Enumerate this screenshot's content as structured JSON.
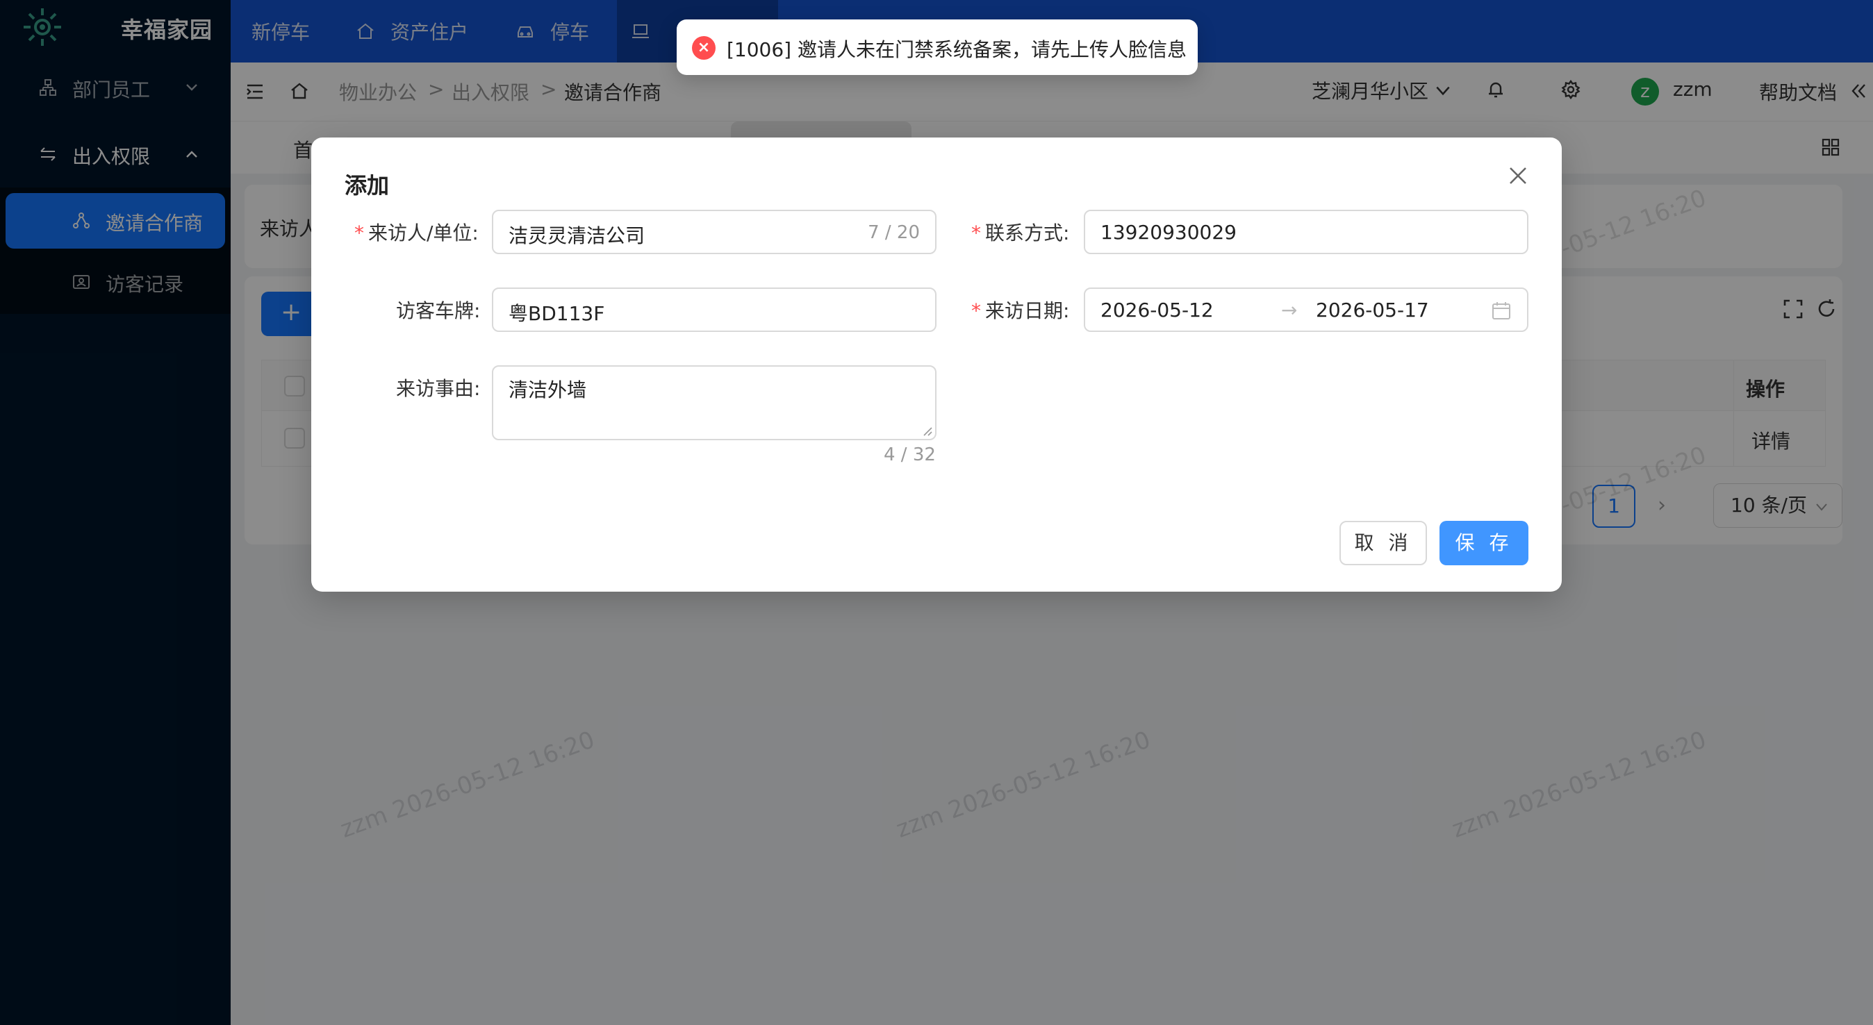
{
  "app": {
    "name": "幸福家园"
  },
  "sidebar": {
    "groups": [
      {
        "label": "部门员工",
        "icon": "org-chart-icon",
        "expanded": false
      },
      {
        "label": "出入权限",
        "icon": "swap-icon",
        "expanded": true
      }
    ],
    "items": [
      {
        "label": "邀请合作商",
        "icon": "share-nodes-icon",
        "active": true
      },
      {
        "label": "访客记录",
        "icon": "id-card-icon",
        "active": false
      }
    ]
  },
  "topnav": {
    "tabs": [
      {
        "label": "新停车",
        "icon": ""
      },
      {
        "label": "资产住户",
        "icon": "home-icon"
      },
      {
        "label": "停车",
        "icon": "car-icon"
      },
      {
        "label": "",
        "icon": "laptop-icon"
      }
    ]
  },
  "header": {
    "breadcrumb": [
      "物业办公",
      "出入权限",
      "邀请合作商"
    ],
    "community": "芝澜月华小区",
    "user_initial": "z",
    "user_name": "zzm",
    "help": "帮助文档"
  },
  "tabs_row": {
    "first_tab": "首"
  },
  "filter": {
    "label": "来访人"
  },
  "table": {
    "action_header": "操作",
    "rows": [
      {
        "action": "详情"
      }
    ]
  },
  "pagination": {
    "current": "1",
    "page_size": "10 条/页"
  },
  "watermark": "zzm 2026-05-12 16:20",
  "modal": {
    "title": "添加",
    "fields": {
      "visitor": {
        "label": "来访人/单位:",
        "value": "洁灵灵清洁公司",
        "count": "7 / 20",
        "required": true
      },
      "contact": {
        "label": "联系方式:",
        "value": "13920930029",
        "required": true
      },
      "plate": {
        "label": "访客车牌:",
        "value": "粤BD113F",
        "required": false
      },
      "date": {
        "label": "来访日期:",
        "start": "2026-05-12",
        "end": "2026-05-17",
        "separator": "→",
        "required": true
      },
      "reason": {
        "label": "来访事由:",
        "value": "清洁外墙",
        "count": "4 / 32",
        "required": false
      }
    },
    "cancel": "取 消",
    "save": "保 存"
  },
  "toast": {
    "type": "error",
    "message": "[1006] 邀请人未在门禁系统备案，请先上传人脸信息"
  },
  "colors": {
    "primary": "#1677ff",
    "sidebar_bg": "#001529",
    "topbar_bg": "#1554d2",
    "error": "#ff4d4f"
  }
}
